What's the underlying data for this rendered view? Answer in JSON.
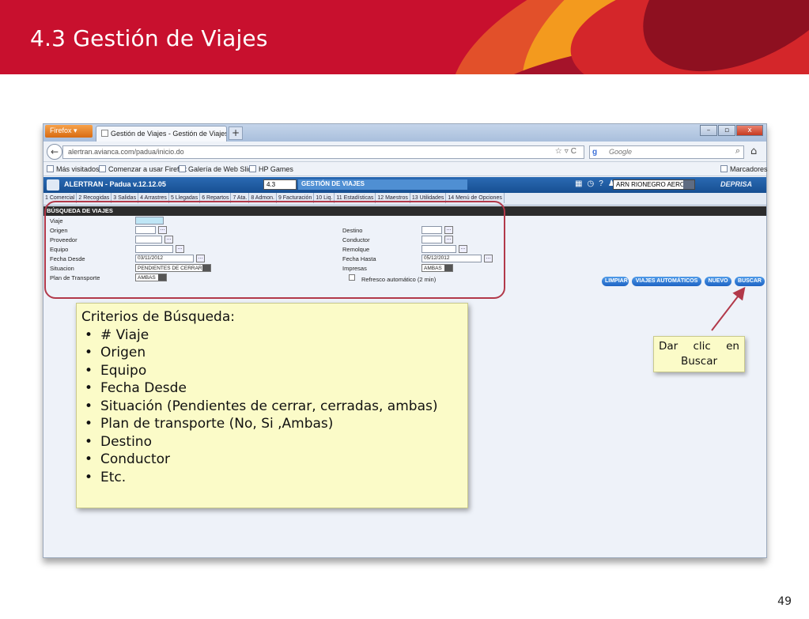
{
  "slide": {
    "title": "4.3 Gestión de Viajes",
    "page_number": "49"
  },
  "browser": {
    "firefox_label": "Firefox",
    "tab_title": "Gestión de Viajes - Gestión de Viajes",
    "new_tab": "+",
    "url": "alertran.avianca.com/padua/inicio.do",
    "search_placeholder": "Google",
    "bookmarks": [
      "Más visitados",
      "Comenzar a usar Firefox",
      "Galería de Web Slice",
      "HP Games"
    ],
    "bookmarks_right": "Marcadores",
    "window_controls": [
      "–",
      "▫",
      "x"
    ]
  },
  "app": {
    "name": "ALERTRAN - Padua  v.12.12.05",
    "module_code": "4.3",
    "module_name": "GESTIÓN DE VIAJES",
    "icons": [
      "calendar-icon",
      "clock-icon",
      "help-icon",
      "user-icon"
    ],
    "icon_glyphs": [
      "▦",
      "◷",
      "?",
      "♟"
    ],
    "station": "ARN RIONEGRO AEROP",
    "brand": "DEPRISA",
    "menu": [
      "1 Comercial",
      "2 Recogidas",
      "3 Salidas",
      "4 Arrastres",
      "5 Llegadas",
      "6 Repartos",
      "7 Ata.",
      "8 Admon.",
      "9 Facturación",
      "10 Liq.",
      "11 Estadísticas",
      "12 Maestros",
      "13 Utilidades",
      "14 Menú de Opciones"
    ]
  },
  "search_form": {
    "section_title": "BÚSQUEDA DE VIAJES",
    "labels": {
      "viaje": "Viaje",
      "origen": "Origen",
      "proveedor": "Proveedor",
      "equipo": "Equipo",
      "fecha_desde": "Fecha Desde",
      "situacion": "Situacion",
      "plan_transporte": "Plan de Transporte",
      "destino": "Destino",
      "conductor": "Conductor",
      "remolque": "Remolque",
      "fecha_hasta": "Fecha Hasta",
      "impresas": "Impresas",
      "refresco": "Refresco automático (2 min)"
    },
    "values": {
      "fecha_desde": "03/11/2012",
      "fecha_hasta": "05/12/2012",
      "situacion": "PENDIENTES DE CERRAR",
      "plan_transporte": "AMBAS",
      "impresas": "AMBAS"
    },
    "lookup_button": "...",
    "buttons": {
      "limpiar": "LIMPIAR",
      "viajes_automaticos": "VIAJES AUTOMÁTICOS",
      "nuevo": "NUEVO",
      "buscar": "BUSCAR"
    }
  },
  "annotation": {
    "heading": "Criterios de Búsqueda:",
    "items": [
      "# Viaje",
      "Origen",
      "Equipo",
      "Fecha Desde",
      "Situación (Pendientes de cerrar, cerradas, ambas)",
      "Plan de transporte (No, Si ,Ambas)",
      "Destino",
      "Conductor",
      "Etc."
    ]
  },
  "callout": {
    "line1_words": [
      "Dar",
      "clic",
      "en"
    ],
    "line2": "Buscar"
  },
  "colors": {
    "header_red": "#c8102e",
    "note_bg": "#fbfbc8",
    "highlight_border": "#b2394a",
    "arrow": "#b2394a",
    "app_blue": "#1e64c4"
  }
}
